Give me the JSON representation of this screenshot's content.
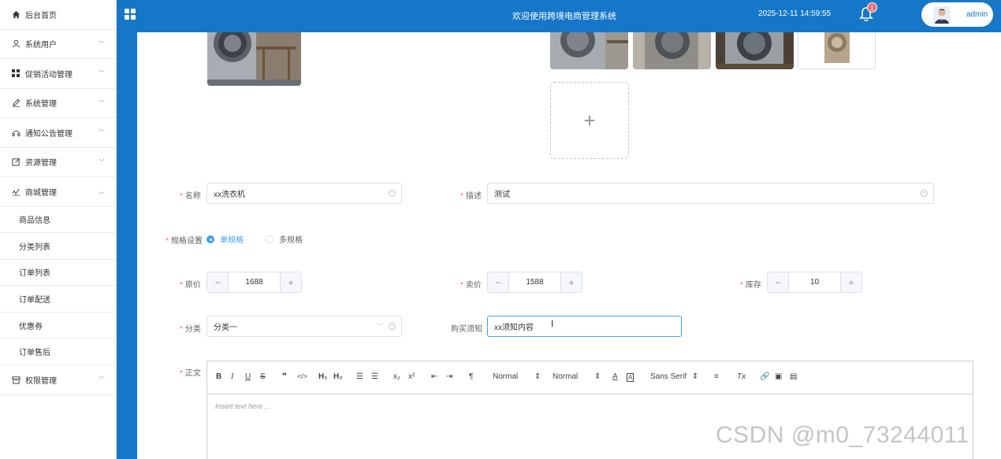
{
  "sidebar": {
    "items": [
      {
        "label": "后台首页",
        "icon": "home-icon"
      },
      {
        "label": "系统用户",
        "icon": "user-icon"
      },
      {
        "label": "促销活动管理",
        "icon": "grid-icon"
      },
      {
        "label": "系统管理",
        "icon": "edit-icon"
      },
      {
        "label": "通知公告管理",
        "icon": "headset-icon"
      },
      {
        "label": "资源管理",
        "icon": "doc-edit-icon"
      },
      {
        "label": "商城管理",
        "icon": "chart-icon"
      }
    ],
    "sub_items": [
      "商品信息",
      "分类列表",
      "订单列表",
      "订单配送",
      "优惠券",
      "订单售后"
    ],
    "last_item": {
      "label": "权限管理",
      "icon": "box-icon"
    }
  },
  "header": {
    "title": "欢迎使用跨境电商管理系统",
    "datetime": "2025-12-11 14:59:55",
    "notification_count": "1",
    "username": "admin",
    "accent_color": "#1677c9"
  },
  "form": {
    "name_label": "名称",
    "name_value": "xx洗衣机",
    "desc_label": "描述",
    "desc_value": "测试",
    "spec_label": "规格设置",
    "spec_options": [
      "单规格",
      "多规格"
    ],
    "spec_selected": "单规格",
    "original_price_label": "原价",
    "original_price": "1688",
    "sale_price_label": "卖价",
    "sale_price": "1588",
    "stock_label": "库存",
    "stock": "10",
    "category_label": "分类",
    "category_value": "分类一",
    "notice_label": "购买须知",
    "notice_value": "xx须知内容",
    "content_label": "正文",
    "upload_plus": "+"
  },
  "editor": {
    "placeholder": "Insert text here ...",
    "header_select": "Normal",
    "size_select": "Normal",
    "font_select": "Sans Serif"
  },
  "watermark": "CSDN @m0_73244011"
}
